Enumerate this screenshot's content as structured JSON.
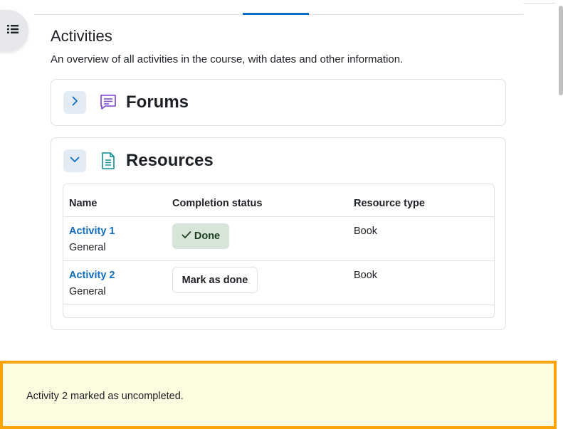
{
  "page": {
    "title": "Activities",
    "description": "An overview of all activities in the course, with dates and other information."
  },
  "sections": {
    "forums": {
      "title": "Forums",
      "expanded": false,
      "icon": "forum-icon"
    },
    "resources": {
      "title": "Resources",
      "expanded": true,
      "icon": "file-icon",
      "columns": [
        "Name",
        "Completion status",
        "Resource type"
      ],
      "rows": [
        {
          "name": "Activity 1",
          "section": "General",
          "completion": "Done",
          "type": "Book"
        },
        {
          "name": "Activity 2",
          "section": "General",
          "completion": "Mark as done",
          "type": "Book"
        }
      ]
    }
  },
  "toast": {
    "message": "Activity 2 marked as uncompleted."
  },
  "colors": {
    "accent": "#0f6cbf",
    "forum_icon": "#7a3fd1",
    "file_icon": "#0e8a92",
    "done_bg": "#d7e4d8",
    "toast_border": "#f9a308",
    "toast_bg": "#fdfbe0"
  }
}
